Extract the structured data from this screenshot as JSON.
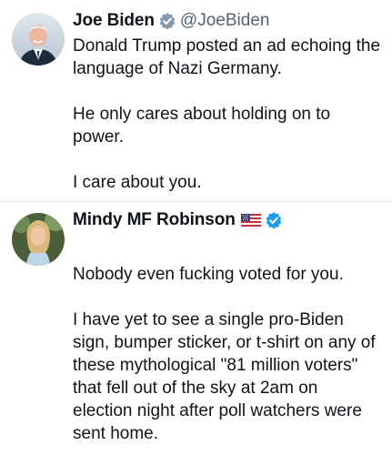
{
  "posts": [
    {
      "author": {
        "name": "Joe Biden",
        "handle": "@JoeBiden",
        "verified": true,
        "verified_color": "#829aab"
      },
      "paragraphs": [
        "Donald Trump posted an ad echoing the language of Nazi Germany.",
        "He only cares about holding on to power.",
        "I care about you."
      ]
    },
    {
      "author": {
        "name": "Mindy MF Robinson",
        "flag": "us-flag-icon",
        "verified": true,
        "verified_color": "#1d9bf0"
      },
      "paragraphs": [
        "Nobody even fucking voted for you.",
        "I have yet to see a single pro-Biden sign, bumper sticker, or t-shirt on any of these mythological \"81 million voters\" that fell out of the sky at 2am on election night after poll watchers were sent home."
      ]
    }
  ]
}
